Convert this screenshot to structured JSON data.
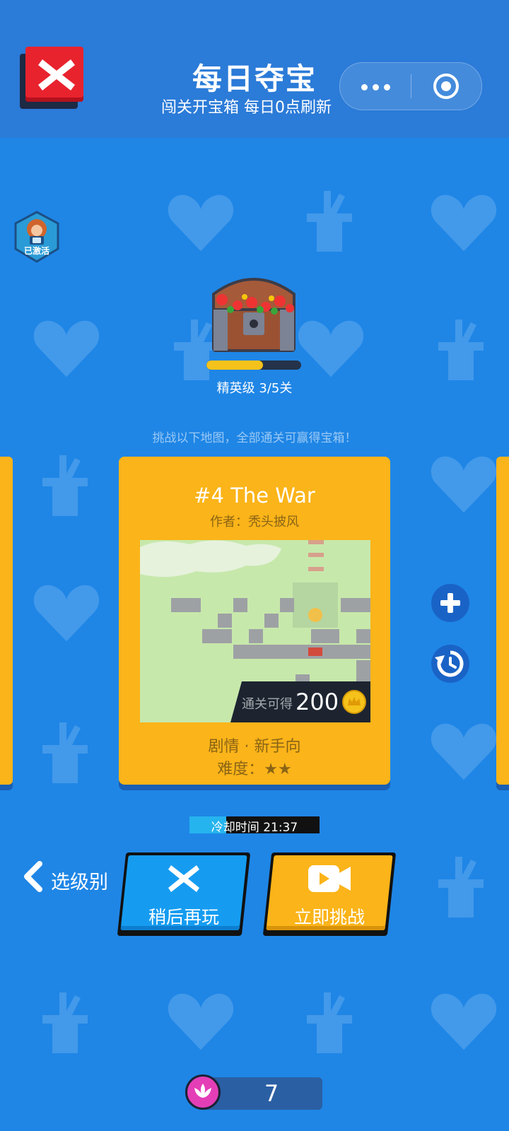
{
  "header": {
    "title": "每日夺宝",
    "subtitle": "闯关开宝箱 每日0点刷新"
  },
  "badge": {
    "label": "已激活"
  },
  "chest": {
    "level_text": "精英级 3/5关",
    "progress_fraction": 0.6
  },
  "challenge_text": "挑战以下地图，全部通关可赢得宝箱！",
  "card": {
    "title": "#4 The War",
    "author": "作者：秃头披风",
    "reward_label": "通关可得",
    "reward_value": "200",
    "tags": "剧情 · 新手向",
    "difficulty": "难度：★★"
  },
  "cooldown": {
    "text": "冷却时间 21:37",
    "progress_fraction": 0.28
  },
  "buttons": {
    "back": "选级别",
    "later": "稍后再玩",
    "challenge": "立即挑战"
  },
  "lotus_count": "7",
  "colors": {
    "background": "#1f86e6",
    "card": "#fbb419",
    "close": "#e8232e",
    "later_button": "#159cf1"
  }
}
